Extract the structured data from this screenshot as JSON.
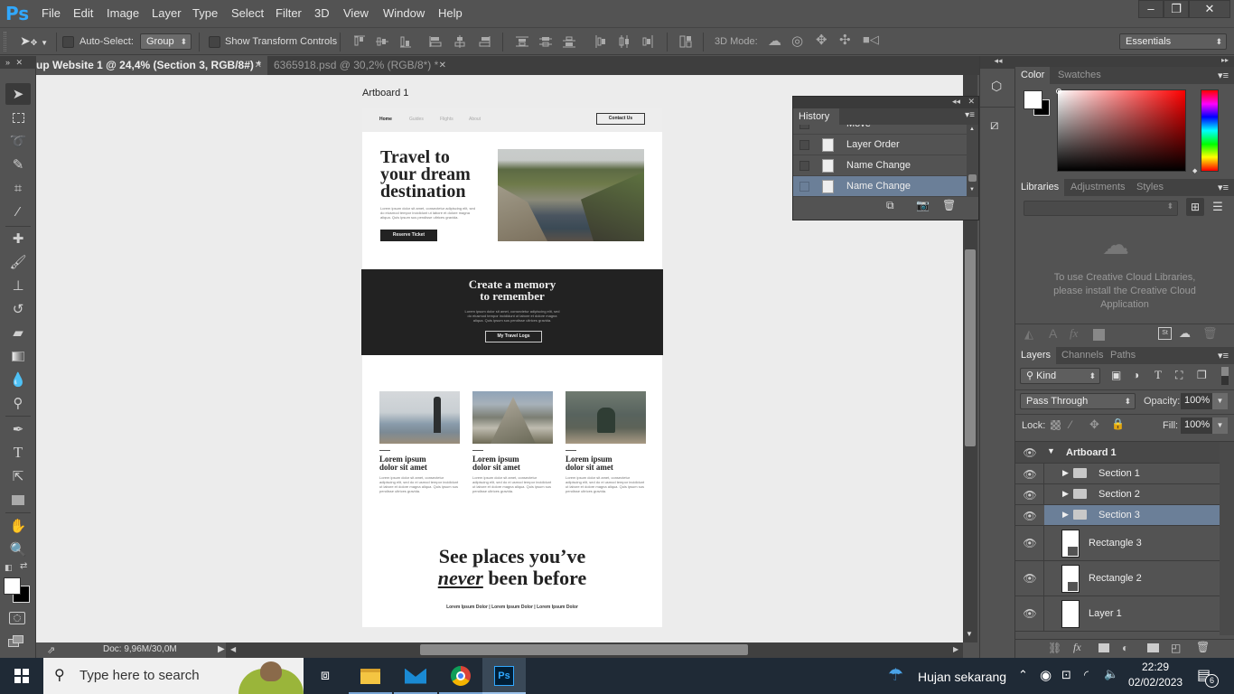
{
  "app": {
    "logo": "Ps",
    "menu": [
      "File",
      "Edit",
      "Image",
      "Layer",
      "Type",
      "Select",
      "Filter",
      "3D",
      "View",
      "Window",
      "Help"
    ],
    "window_controls": {
      "minimize": "–",
      "restore": "❐",
      "close": "✕"
    }
  },
  "options_bar": {
    "auto_select_label": "Auto-Select:",
    "auto_select_checked": false,
    "auto_select_mode": "Group",
    "show_transform_label": "Show Transform Controls",
    "show_transform_checked": false,
    "mode_3d_label": "3D Mode:",
    "workspace": "Essentials"
  },
  "tabs": [
    {
      "label": "up Website 1 @ 24,4% (Section 3, RGB/8#) *",
      "active": true
    },
    {
      "label": "6365918.psd @ 30,2% (RGB/8*) *",
      "active": false
    }
  ],
  "tools": [
    "move",
    "rectangular-marquee",
    "lasso",
    "quick-selection",
    "crop",
    "eyedropper",
    "spot-healing",
    "brush",
    "clone-stamp",
    "history-brush",
    "eraser",
    "gradient",
    "blur",
    "dodge",
    "pen",
    "type",
    "path-selection",
    "rectangle",
    "hand",
    "zoom"
  ],
  "artboard": {
    "name": "Artboard 1",
    "nav": {
      "links": [
        "Home",
        "Guides",
        "Flights",
        "About"
      ],
      "cta": "Contact Us"
    },
    "hero": {
      "title_lines": [
        "Travel to",
        "your dream",
        "destination"
      ],
      "body": "Lorem ipsum dolor sit amet, consectetur adipiscing elit, sed do eiusmod tempor incididunt ut labore et dolore magna aliqua. Quis ipsum sus pendisse ultrices gravida.",
      "button": "Reserve Ticket"
    },
    "banner": {
      "title_lines": [
        "Create a memory",
        "to remember"
      ],
      "body": "Lorem ipsum dolor sit amet, consectetur adipiscing elit, sed do eiusmod tempor incididunt ut labore et dolore magna aliqua. Quis ipsum sus pendisse ultrices gravida.",
      "button": "My Travel Logs"
    },
    "cards": [
      {
        "title_lines": [
          "Lorem ipsum",
          "dolor sit amet"
        ],
        "body": "Lorem ipsum dolor sit amet, consectetur adipiscing elit, sed do ei usmod tempor incididunt ut labore et dolore magna aliqua. Quis ipsum sus pendisse ultrices gravida."
      },
      {
        "title_lines": [
          "Lorem ipsum",
          "dolor sit amet"
        ],
        "body": "Lorem ipsum dolor sit amet, consectetur adipiscing elit, sed do ei usmod tempor incididunt ut labore et dolore magna aliqua. Quis ipsum sus pendisse ultrices gravida."
      },
      {
        "title_lines": [
          "Lorem ipsum",
          "dolor sit amet"
        ],
        "body": "Lorem ipsum dolor sit amet, consectetur adipiscing elit, sed do ei usmod tempor incididunt ut labore et dolore magna aliqua. Quis ipsum sus pendisse ultrices gravida."
      }
    ],
    "closing": {
      "line1": "See places you’ve",
      "emph": "never",
      "line2_rest": " been before",
      "footer": "Lorem Ipsum Dolor | Lorem Ipsum Dolor | Lorem Ipsum Dolor"
    }
  },
  "status": {
    "doc_size": "Doc: 9,96M/30,0M"
  },
  "history": {
    "title": "History",
    "items": [
      {
        "label": "Move",
        "selected": false
      },
      {
        "label": "Layer Order",
        "selected": false
      },
      {
        "label": "Name Change",
        "selected": false
      },
      {
        "label": "Name Change",
        "selected": true
      }
    ]
  },
  "color_panel": {
    "tabs": [
      "Color",
      "Swatches"
    ],
    "foreground": "#ffffff",
    "background": "#000000",
    "hue": "#ff0000"
  },
  "libraries_panel": {
    "tabs": [
      "Libraries",
      "Adjustments",
      "Styles"
    ],
    "message": "To use Creative Cloud Libraries, please install the Creative Cloud Application"
  },
  "layers_panel": {
    "tabs": [
      "Layers",
      "Channels",
      "Paths"
    ],
    "filter_kind": "Kind",
    "blend_mode": "Pass Through",
    "opacity_label": "Opacity:",
    "opacity": "100%",
    "lock_label": "Lock:",
    "fill_label": "Fill:",
    "fill": "100%",
    "layers": [
      {
        "name": "Artboard 1",
        "type": "artboard",
        "expanded": true,
        "selected": false
      },
      {
        "name": "Section 1",
        "type": "group",
        "selected": false
      },
      {
        "name": "Section 2",
        "type": "group",
        "selected": false
      },
      {
        "name": "Section 3",
        "type": "group",
        "selected": true
      },
      {
        "name": "Rectangle 3",
        "type": "shape",
        "selected": false
      },
      {
        "name": "Rectangle 2",
        "type": "shape",
        "selected": false
      },
      {
        "name": "Layer 1",
        "type": "pixel",
        "selected": false
      }
    ]
  },
  "taskbar": {
    "search_placeholder": "Type here to search",
    "weather": "Hujan sekarang",
    "time": "22:29",
    "date": "02/02/2023",
    "notifications": "6"
  }
}
